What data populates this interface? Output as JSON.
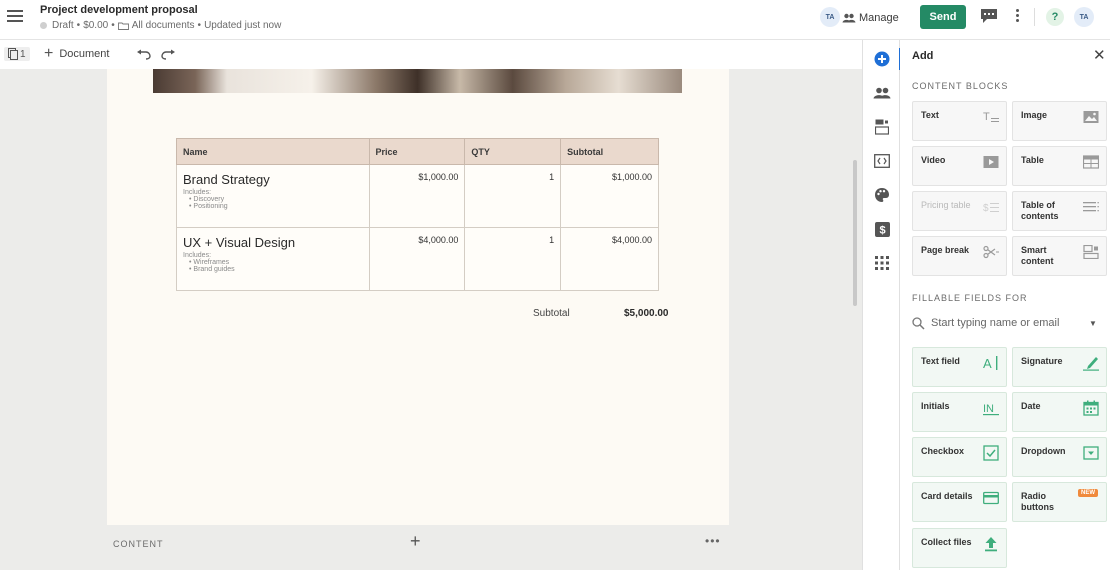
{
  "header": {
    "title": "Project development proposal",
    "status": "Draft",
    "price": "$0.00",
    "folder": "All documents",
    "updated": "Updated just now",
    "avatar_initials": "TA",
    "manage_label": "Manage",
    "send_label": "Send",
    "user_initials": "TA"
  },
  "toolbar": {
    "page_count": "1",
    "add_document_label": "Document"
  },
  "pricing_table": {
    "columns": [
      "Name",
      "Price",
      "QTY",
      "Subtotal"
    ],
    "rows": [
      {
        "name": "Brand Strategy",
        "includes_label": "Includes:",
        "includes": [
          "Discovery",
          "Positioning"
        ],
        "price": "$1,000.00",
        "qty": "1",
        "subtotal": "$1,000.00"
      },
      {
        "name": "UX + Visual Design",
        "includes_label": "Includes:",
        "includes": [
          "Wireframes",
          "Brand guides"
        ],
        "price": "$4,000.00",
        "qty": "1",
        "subtotal": "$4,000.00"
      }
    ],
    "subtotal_label": "Subtotal",
    "subtotal_value": "$5,000.00"
  },
  "content_bar": {
    "label": "CONTENT",
    "add_symbol": "+",
    "more_symbol": "•••"
  },
  "panel": {
    "title": "Add",
    "close_symbol": "✕",
    "content_blocks_label": "CONTENT BLOCKS",
    "content_blocks": [
      {
        "label": "Text",
        "icon": "text-icon",
        "enabled": true
      },
      {
        "label": "Image",
        "icon": "image-icon",
        "enabled": true
      },
      {
        "label": "Video",
        "icon": "video-icon",
        "enabled": true
      },
      {
        "label": "Table",
        "icon": "table-icon",
        "enabled": true
      },
      {
        "label": "Pricing table",
        "icon": "pricing-table-icon",
        "enabled": false
      },
      {
        "label": "Table of contents",
        "icon": "table-of-contents-icon",
        "enabled": true
      },
      {
        "label": "Page break",
        "icon": "page-break-icon",
        "enabled": true
      },
      {
        "label": "Smart content",
        "icon": "smart-content-icon",
        "enabled": true
      }
    ],
    "fillable_label": "FILLABLE FIELDS FOR",
    "recipient_placeholder": "Start typing name or email",
    "fields": [
      {
        "label": "Text field",
        "icon": "text-field-icon"
      },
      {
        "label": "Signature",
        "icon": "signature-icon"
      },
      {
        "label": "Initials",
        "icon": "initials-icon"
      },
      {
        "label": "Date",
        "icon": "date-icon"
      },
      {
        "label": "Checkbox",
        "icon": "checkbox-icon"
      },
      {
        "label": "Dropdown",
        "icon": "dropdown-icon"
      },
      {
        "label": "Card details",
        "icon": "card-details-icon"
      },
      {
        "label": "Radio buttons",
        "icon": "radio-buttons-icon",
        "badge": "NEW"
      },
      {
        "label": "Collect files",
        "icon": "collect-files-icon"
      }
    ]
  },
  "colors": {
    "accent_green": "#248a65",
    "accent_blue": "#1f6fd6",
    "new_badge": "#f08a3c",
    "table_header": "#ead9cd",
    "page_bg": "#fdfaf4"
  }
}
